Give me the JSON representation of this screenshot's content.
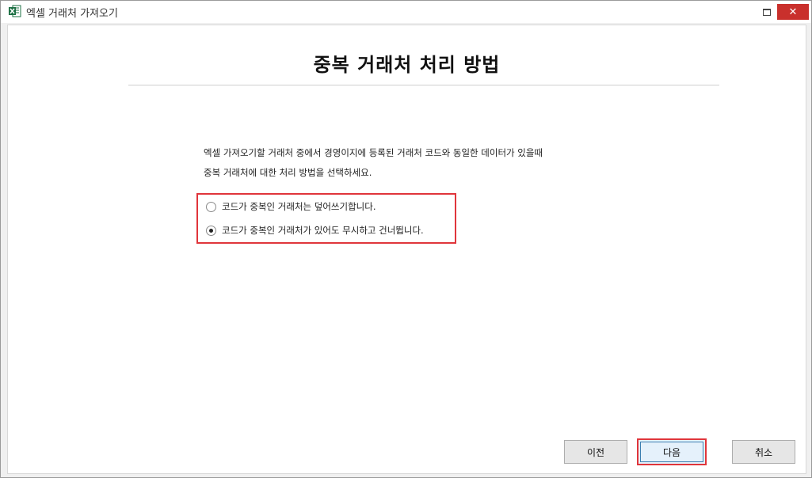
{
  "window": {
    "title": "엑셀 거래처 가져오기",
    "close_glyph": "✕"
  },
  "page": {
    "title": "중복 거래처 처리 방법",
    "description_line1": "엑셀 가져오기할 거래처 중에서 경영이지에 등록된 거래처 코드와 동일한 데이터가 있을때",
    "description_line2": "중복 거래처에 대한 처리 방법을 선택하세요."
  },
  "options": [
    {
      "label": "코드가 중복인 거래처는 덮어쓰기합니다.",
      "selected": false
    },
    {
      "label": "코드가 중복인 거래처가 있어도 무시하고 건너뜁니다.",
      "selected": true
    }
  ],
  "buttons": {
    "prev": "이전",
    "next": "다음",
    "cancel": "취소"
  },
  "colors": {
    "highlight": "#e0353b",
    "excel_green": "#1d7044"
  }
}
